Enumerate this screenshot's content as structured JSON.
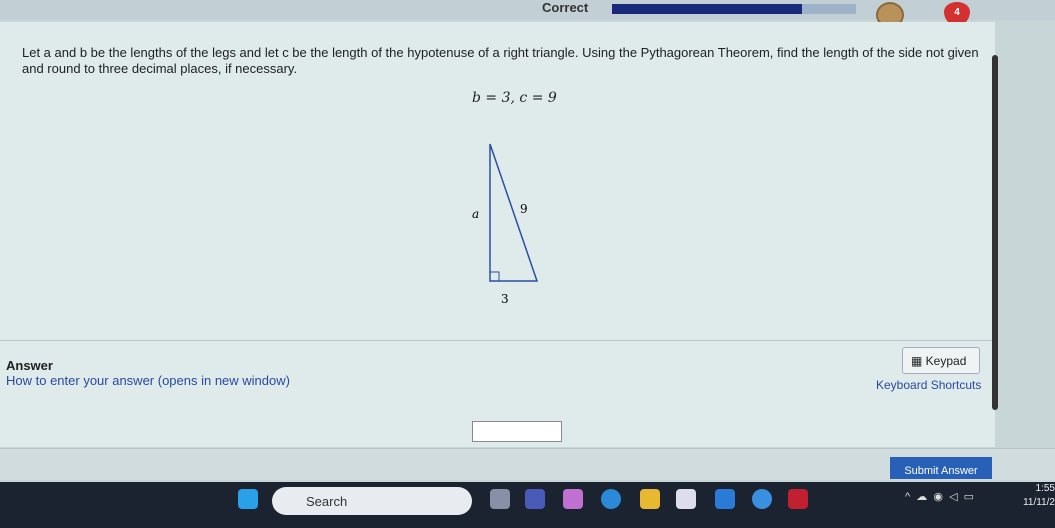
{
  "header": {
    "status": "Correct",
    "progress_percent": 78,
    "lives": "4",
    "colors": {
      "progress": "#1a2a7a",
      "heart": "#d43030"
    }
  },
  "question": {
    "text": "Let a and b be the lengths of the legs and let c be the length of the hypotenuse of a right triangle. Using the Pythagorean Theorem, find the length of the side not given and round to three decimal places, if necessary.",
    "equation": "b = 3, c = 9",
    "labels": {
      "a": "a",
      "c": "9",
      "b": "3"
    }
  },
  "answer": {
    "heading": "Answer",
    "howto": "How to enter your answer (opens in new window)",
    "keypad": "Keypad",
    "shortcuts": "Keyboard Shortcuts",
    "value": ""
  },
  "footer": {
    "submit": "Submit Answer"
  },
  "taskbar": {
    "search": "Search",
    "time": "1:55",
    "date": "11/11/2"
  }
}
